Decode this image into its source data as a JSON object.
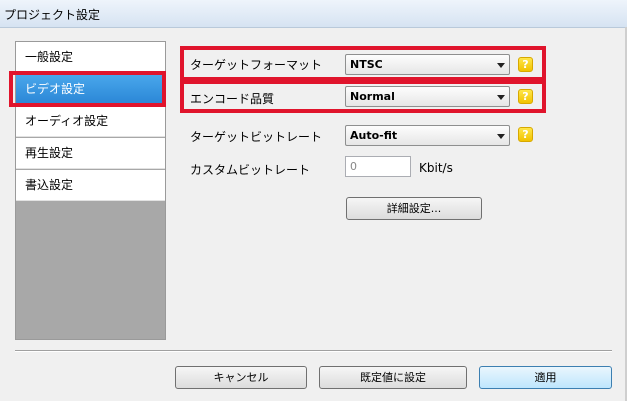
{
  "window": {
    "title": "プロジェクト設定"
  },
  "sidebar": {
    "items": [
      {
        "label": "一般設定",
        "selected": false
      },
      {
        "label": "ビデオ設定",
        "selected": true
      },
      {
        "label": "オーディオ設定",
        "selected": false
      },
      {
        "label": "再生設定",
        "selected": false
      },
      {
        "label": "書込設定",
        "selected": false
      }
    ]
  },
  "video": {
    "target_format": {
      "label": "ターゲットフォーマット",
      "value": "NTSC"
    },
    "encode_quality": {
      "label": "エンコード品質",
      "value": "Normal"
    },
    "target_bitrate": {
      "label": "ターゲットビットレート",
      "value": "Auto-fit"
    },
    "custom_bitrate": {
      "label": "カスタムビットレート",
      "value": "0",
      "unit": "Kbit/s"
    },
    "advanced_button": "詳細設定...",
    "help_glyph": "?"
  },
  "footer": {
    "cancel": "キャンセル",
    "defaults": "既定値に設定",
    "apply": "適用"
  },
  "colors": {
    "highlight": "#e0142c",
    "selected_item": "#2a86d6",
    "help_icon": "#f2c200"
  },
  "icons": {
    "help": "question-help-icon",
    "dropdown": "chevron-down-icon"
  }
}
